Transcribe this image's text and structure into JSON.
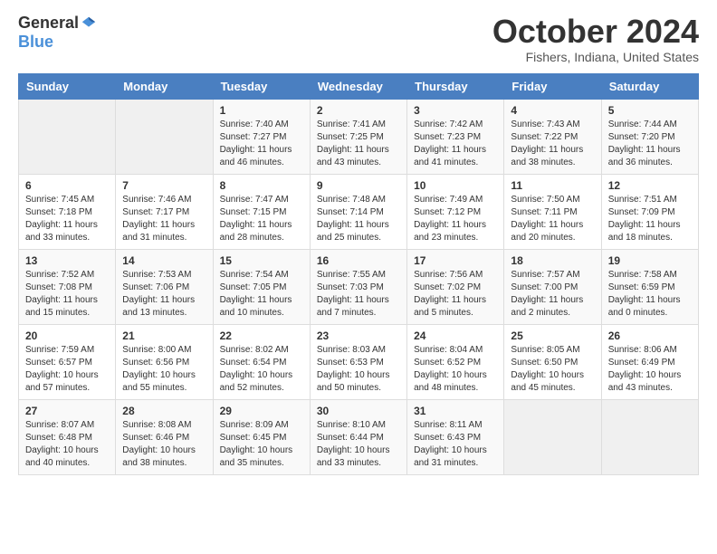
{
  "header": {
    "logo_general": "General",
    "logo_blue": "Blue",
    "month_title": "October 2024",
    "subtitle": "Fishers, Indiana, United States"
  },
  "weekdays": [
    "Sunday",
    "Monday",
    "Tuesday",
    "Wednesday",
    "Thursday",
    "Friday",
    "Saturday"
  ],
  "weeks": [
    [
      {
        "day": "",
        "info": ""
      },
      {
        "day": "",
        "info": ""
      },
      {
        "day": "1",
        "info": "Sunrise: 7:40 AM\nSunset: 7:27 PM\nDaylight: 11 hours and 46 minutes."
      },
      {
        "day": "2",
        "info": "Sunrise: 7:41 AM\nSunset: 7:25 PM\nDaylight: 11 hours and 43 minutes."
      },
      {
        "day": "3",
        "info": "Sunrise: 7:42 AM\nSunset: 7:23 PM\nDaylight: 11 hours and 41 minutes."
      },
      {
        "day": "4",
        "info": "Sunrise: 7:43 AM\nSunset: 7:22 PM\nDaylight: 11 hours and 38 minutes."
      },
      {
        "day": "5",
        "info": "Sunrise: 7:44 AM\nSunset: 7:20 PM\nDaylight: 11 hours and 36 minutes."
      }
    ],
    [
      {
        "day": "6",
        "info": "Sunrise: 7:45 AM\nSunset: 7:18 PM\nDaylight: 11 hours and 33 minutes."
      },
      {
        "day": "7",
        "info": "Sunrise: 7:46 AM\nSunset: 7:17 PM\nDaylight: 11 hours and 31 minutes."
      },
      {
        "day": "8",
        "info": "Sunrise: 7:47 AM\nSunset: 7:15 PM\nDaylight: 11 hours and 28 minutes."
      },
      {
        "day": "9",
        "info": "Sunrise: 7:48 AM\nSunset: 7:14 PM\nDaylight: 11 hours and 25 minutes."
      },
      {
        "day": "10",
        "info": "Sunrise: 7:49 AM\nSunset: 7:12 PM\nDaylight: 11 hours and 23 minutes."
      },
      {
        "day": "11",
        "info": "Sunrise: 7:50 AM\nSunset: 7:11 PM\nDaylight: 11 hours and 20 minutes."
      },
      {
        "day": "12",
        "info": "Sunrise: 7:51 AM\nSunset: 7:09 PM\nDaylight: 11 hours and 18 minutes."
      }
    ],
    [
      {
        "day": "13",
        "info": "Sunrise: 7:52 AM\nSunset: 7:08 PM\nDaylight: 11 hours and 15 minutes."
      },
      {
        "day": "14",
        "info": "Sunrise: 7:53 AM\nSunset: 7:06 PM\nDaylight: 11 hours and 13 minutes."
      },
      {
        "day": "15",
        "info": "Sunrise: 7:54 AM\nSunset: 7:05 PM\nDaylight: 11 hours and 10 minutes."
      },
      {
        "day": "16",
        "info": "Sunrise: 7:55 AM\nSunset: 7:03 PM\nDaylight: 11 hours and 7 minutes."
      },
      {
        "day": "17",
        "info": "Sunrise: 7:56 AM\nSunset: 7:02 PM\nDaylight: 11 hours and 5 minutes."
      },
      {
        "day": "18",
        "info": "Sunrise: 7:57 AM\nSunset: 7:00 PM\nDaylight: 11 hours and 2 minutes."
      },
      {
        "day": "19",
        "info": "Sunrise: 7:58 AM\nSunset: 6:59 PM\nDaylight: 11 hours and 0 minutes."
      }
    ],
    [
      {
        "day": "20",
        "info": "Sunrise: 7:59 AM\nSunset: 6:57 PM\nDaylight: 10 hours and 57 minutes."
      },
      {
        "day": "21",
        "info": "Sunrise: 8:00 AM\nSunset: 6:56 PM\nDaylight: 10 hours and 55 minutes."
      },
      {
        "day": "22",
        "info": "Sunrise: 8:02 AM\nSunset: 6:54 PM\nDaylight: 10 hours and 52 minutes."
      },
      {
        "day": "23",
        "info": "Sunrise: 8:03 AM\nSunset: 6:53 PM\nDaylight: 10 hours and 50 minutes."
      },
      {
        "day": "24",
        "info": "Sunrise: 8:04 AM\nSunset: 6:52 PM\nDaylight: 10 hours and 48 minutes."
      },
      {
        "day": "25",
        "info": "Sunrise: 8:05 AM\nSunset: 6:50 PM\nDaylight: 10 hours and 45 minutes."
      },
      {
        "day": "26",
        "info": "Sunrise: 8:06 AM\nSunset: 6:49 PM\nDaylight: 10 hours and 43 minutes."
      }
    ],
    [
      {
        "day": "27",
        "info": "Sunrise: 8:07 AM\nSunset: 6:48 PM\nDaylight: 10 hours and 40 minutes."
      },
      {
        "day": "28",
        "info": "Sunrise: 8:08 AM\nSunset: 6:46 PM\nDaylight: 10 hours and 38 minutes."
      },
      {
        "day": "29",
        "info": "Sunrise: 8:09 AM\nSunset: 6:45 PM\nDaylight: 10 hours and 35 minutes."
      },
      {
        "day": "30",
        "info": "Sunrise: 8:10 AM\nSunset: 6:44 PM\nDaylight: 10 hours and 33 minutes."
      },
      {
        "day": "31",
        "info": "Sunrise: 8:11 AM\nSunset: 6:43 PM\nDaylight: 10 hours and 31 minutes."
      },
      {
        "day": "",
        "info": ""
      },
      {
        "day": "",
        "info": ""
      }
    ]
  ]
}
